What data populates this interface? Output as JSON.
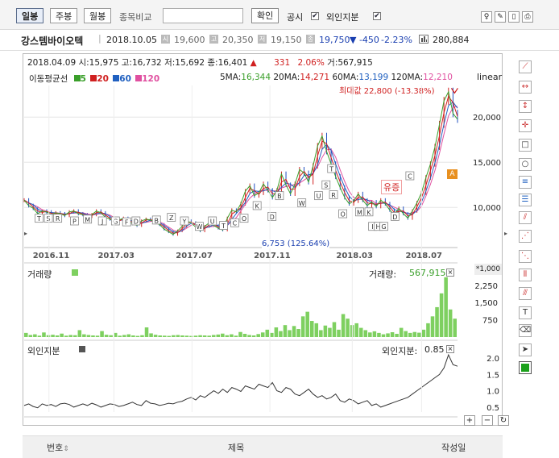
{
  "toolbar": {
    "periods": [
      {
        "label": "일봉",
        "active": true
      },
      {
        "label": "주봉",
        "active": false
      },
      {
        "label": "월봉",
        "active": false
      }
    ],
    "compare_label": "종목비교",
    "compare_value": "",
    "confirm_label": "확인",
    "disclosure_label": "공시",
    "foreign_label": "외인지분",
    "check_mark": "✔"
  },
  "stock": {
    "name": "강스템바이오텍",
    "date": "2018.10.05",
    "open_icon": "시",
    "open": "19,600",
    "high_icon": "고",
    "high": "20,350",
    "low_icon": "저",
    "low": "19,150",
    "close_icon": "종",
    "close": "19,750",
    "change": "▼ -450",
    "change_pct": "-2.23%",
    "volume": "280,884"
  },
  "chart_data": {
    "type": "line",
    "hover_info": {
      "date": "2018.04.09",
      "open_label": "시:",
      "open": "15,975",
      "high_label": "고:",
      "high": "16,732",
      "low_label": "저:",
      "low": "15,692",
      "close_label": "종:",
      "close": "16,401",
      "change_symbol": "▲",
      "change": "331",
      "change_pct": "2.06%",
      "volume_label": "거:",
      "volume": "567,915"
    },
    "ma_legend_label": "이동평균선",
    "ma_periods": [
      {
        "label": "5",
        "color": "#3a9f2a"
      },
      {
        "label": "20",
        "color": "#d02020"
      },
      {
        "label": "60",
        "color": "#2060c0"
      },
      {
        "label": "120",
        "color": "#e050a0"
      }
    ],
    "ma_values": [
      {
        "label": "5MA:",
        "value": "16,344",
        "color": "#3a9f2a"
      },
      {
        "label": "20MA:",
        "value": "14,271",
        "color": "#d02020"
      },
      {
        "label": "60MA:",
        "value": "13,199",
        "color": "#2060c0"
      },
      {
        "label": "120MA:",
        "value": "12,210",
        "color": "#e050a0"
      }
    ],
    "scale_label": "linear",
    "max_annotation": "최대값 22,800 (-13.38%)",
    "min_annotation": "6,753 (125.64%)",
    "event_label": "유증",
    "price_axis": {
      "ticks": [
        10000,
        15000,
        20000
      ],
      "tick_labels": [
        "10,000",
        "15,000",
        "20,000"
      ],
      "ylim": [
        6000,
        23500
      ]
    },
    "x_ticks": [
      "2016.11",
      "2017.03",
      "2017.07",
      "2017.11",
      "2018.03",
      "2018.07"
    ],
    "price_series": [
      10800,
      10200,
      9900,
      9300,
      9600,
      9500,
      9200,
      9400,
      9300,
      9100,
      9500,
      9600,
      9300,
      9200,
      9000,
      9200,
      9600,
      9400,
      8900,
      8700,
      8400,
      8600,
      8800,
      8500,
      8200,
      8000,
      8500,
      8700,
      8600,
      8300,
      8100,
      7600,
      7300,
      7000,
      7400,
      7900,
      8500,
      8300,
      7800,
      7400,
      7900,
      8300,
      8000,
      7700,
      7500,
      8800,
      9700,
      9500,
      10400,
      11800,
      12400,
      11300,
      11600,
      12600,
      11900,
      11100,
      11900,
      13700,
      12500,
      11500,
      12600,
      14200,
      13800,
      12800,
      14600,
      16800,
      17900,
      16200,
      14800,
      13400,
      12200,
      11100,
      10400,
      10700,
      11500,
      10800,
      10200,
      10600,
      10100,
      10800,
      10400,
      9700,
      9200,
      9900,
      9300,
      8800,
      9600,
      10500,
      11600,
      13300,
      14800,
      16700,
      19200,
      21800,
      22800,
      20400,
      19750
    ],
    "disclosure_markers": [
      {
        "label": "T",
        "x": 0.04,
        "price": 8800
      },
      {
        "label": "S",
        "x": 0.065,
        "price": 8800
      },
      {
        "label": "R",
        "x": 0.09,
        "price": 8800
      },
      {
        "label": "P",
        "x": 0.135,
        "price": 8500
      },
      {
        "label": "M",
        "x": 0.17,
        "price": 8700
      },
      {
        "label": "J",
        "x": 0.21,
        "price": 8500
      },
      {
        "label": "G",
        "x": 0.245,
        "price": 8500
      },
      {
        "label": "F",
        "x": 0.275,
        "price": 8400
      },
      {
        "label": "D",
        "x": 0.3,
        "price": 8500
      },
      {
        "label": "B",
        "x": 0.355,
        "price": 8600
      },
      {
        "label": "Z",
        "x": 0.395,
        "price": 8900
      },
      {
        "label": "Y",
        "x": 0.43,
        "price": 8500
      },
      {
        "label": "W",
        "x": 0.47,
        "price": 7900
      },
      {
        "label": "U",
        "x": 0.505,
        "price": 8500
      },
      {
        "label": "T",
        "x": 0.535,
        "price": 8000
      },
      {
        "label": "C",
        "x": 0.565,
        "price": 8300
      },
      {
        "label": "O",
        "x": 0.59,
        "price": 8800
      },
      {
        "label": "K",
        "x": 0.625,
        "price": 10200
      },
      {
        "label": "D",
        "x": 0.665,
        "price": 9000
      },
      {
        "label": "B",
        "x": 0.685,
        "price": 11300
      },
      {
        "label": "W",
        "x": 0.745,
        "price": 10500
      },
      {
        "label": "U",
        "x": 0.79,
        "price": 11300
      },
      {
        "label": "S",
        "x": 0.81,
        "price": 12500
      },
      {
        "label": "T",
        "x": 0.825,
        "price": 14300
      },
      {
        "label": "R",
        "x": 0.83,
        "price": 11400
      },
      {
        "label": "O",
        "x": 0.855,
        "price": 9300
      },
      {
        "label": "M",
        "x": 0.9,
        "price": 9500
      },
      {
        "label": "K",
        "x": 0.925,
        "price": 9500
      },
      {
        "label": "I",
        "x": 0.935,
        "price": 7900
      },
      {
        "label": "H",
        "x": 0.95,
        "price": 7900
      },
      {
        "label": "G",
        "x": 0.965,
        "price": 7900
      },
      {
        "label": "D",
        "x": 0.995,
        "price": 9000
      },
      {
        "label": "C",
        "x": 1.035,
        "price": 13500
      }
    ],
    "volume_panel": {
      "label": "거래량",
      "value_label": "거래량:",
      "value": "567,915",
      "scale_note": "*1,000",
      "ticks": [
        750,
        1500,
        2250
      ],
      "tick_labels": [
        "750",
        "1,500",
        "2,250"
      ],
      "ylim": [
        0,
        2700
      ]
    },
    "volume_series": [
      180,
      90,
      120,
      60,
      200,
      80,
      100,
      70,
      150,
      60,
      90,
      80,
      300,
      120,
      90,
      70,
      60,
      260,
      100,
      80,
      180,
      60,
      90,
      120,
      70,
      50,
      80,
      420,
      160,
      100,
      70,
      60,
      50,
      80,
      90,
      70,
      60,
      50,
      60,
      80,
      70,
      60,
      90,
      110,
      150,
      80,
      120,
      60,
      220,
      140,
      90,
      70,
      130,
      200,
      320,
      180,
      420,
      260,
      520,
      300,
      480,
      350,
      900,
      1100,
      700,
      600,
      300,
      500,
      400,
      650,
      320,
      1000,
      800,
      520,
      600,
      400,
      300,
      200,
      250,
      180,
      120,
      160,
      210,
      140,
      400,
      260,
      180,
      220,
      190,
      320,
      600,
      900,
      1300,
      1900,
      2600,
      1200,
      800
    ],
    "foreign_panel": {
      "label": "외인지분",
      "value_label": "외인지분:",
      "value": "0.85",
      "ticks": [
        0.5,
        1.0,
        1.5,
        2.0
      ],
      "tick_labels": [
        "0.5",
        "1.0",
        "1.5",
        "2.0"
      ],
      "ylim": [
        0.35,
        2.2
      ]
    },
    "foreign_series": [
      0.55,
      0.6,
      0.52,
      0.48,
      0.6,
      0.55,
      0.58,
      0.52,
      0.6,
      0.62,
      0.58,
      0.5,
      0.55,
      0.6,
      0.55,
      0.62,
      0.57,
      0.5,
      0.55,
      0.6,
      0.58,
      0.52,
      0.55,
      0.6,
      0.65,
      0.58,
      0.55,
      0.7,
      0.62,
      0.6,
      0.55,
      0.58,
      0.62,
      0.6,
      0.65,
      0.68,
      0.75,
      0.8,
      0.72,
      0.85,
      0.8,
      0.9,
      1.0,
      0.92,
      1.05,
      0.95,
      1.1,
      1.05,
      0.98,
      1.15,
      1.1,
      1.05,
      1.2,
      1.15,
      1.1,
      1.25,
      1.0,
      0.95,
      1.1,
      1.05,
      0.9,
      0.85,
      0.95,
      1.05,
      0.9,
      0.8,
      0.85,
      0.75,
      0.8,
      0.9,
      0.7,
      0.65,
      0.75,
      0.7,
      0.6,
      0.65,
      0.7,
      0.55,
      0.6,
      0.5,
      0.55,
      0.6,
      0.65,
      0.7,
      0.75,
      0.8,
      0.9,
      1.0,
      1.1,
      1.2,
      1.3,
      1.4,
      1.5,
      1.7,
      2.1,
      1.8,
      1.75
    ]
  },
  "legend_icons": [
    "plus-icon",
    "minus-icon",
    "refresh-icon"
  ],
  "footer": {
    "col_no": "번호",
    "sort_symbol": "⇕",
    "col_title": "제목",
    "col_date": "작성일"
  }
}
